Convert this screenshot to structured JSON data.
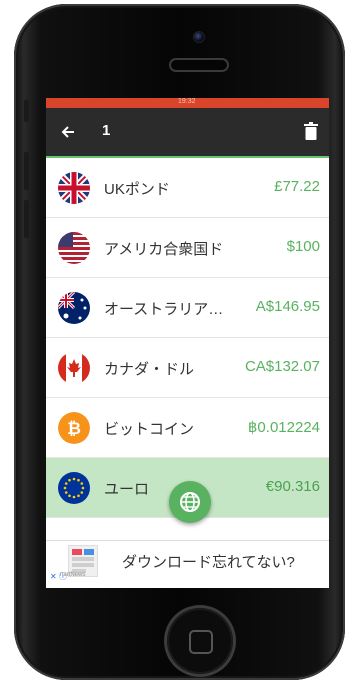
{
  "app": {
    "title": "1"
  },
  "statusbar": {
    "time": "19:32"
  },
  "currencies": [
    {
      "name": "UKポンド",
      "amount": "£77.22",
      "flag": "uk-flag-icon"
    },
    {
      "name": "アメリカ合衆国ドル",
      "amount": "$100",
      "flag": "us-flag-icon"
    },
    {
      "name": "オーストラリア…",
      "amount": "A$146.95",
      "flag": "australia-flag-icon"
    },
    {
      "name": "カナダ・ドル",
      "amount": "CA$132.07",
      "flag": "canada-flag-icon"
    },
    {
      "name": "ビットコイン",
      "amount": "฿0.012224",
      "flag": "bitcoin-icon"
    },
    {
      "name": "ユーロ",
      "amount": "€90.316",
      "flag": "eu-flag-icon"
    }
  ],
  "ad": {
    "text": "ダウンロード忘れてない?",
    "close": "✕ ⓘ",
    "source": "nartNews"
  },
  "colors": {
    "accent": "#58b25f",
    "appbar": "#2b2b2b",
    "selected_row": "#c5e6c4",
    "statusbar": "#d9452a"
  }
}
